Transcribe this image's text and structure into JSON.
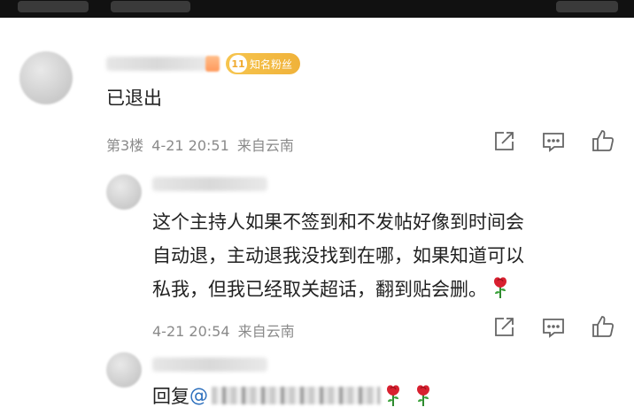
{
  "comment": {
    "fan_badge": {
      "level": "11",
      "label": "知名粉丝"
    },
    "text": "已退出",
    "floor": "第3楼",
    "time": "4-21 20:51",
    "source": "来自云南"
  },
  "reply": {
    "lines": [
      "这个主持人如果不签到和不发帖好像到时间会",
      "自动退，主动退我没找到在哪，如果知道可以",
      "私我，但我已经取关超话，翻到贴会删。"
    ],
    "time": "4-21 20:54",
    "source": "来自云南",
    "emoji": "rose-icon"
  },
  "sub_reply": {
    "prefix": "回复",
    "at": "@",
    "emoji": "rose-icon"
  },
  "icons": [
    "share-icon",
    "comment-icon",
    "like-icon"
  ],
  "colors": {
    "meta": "#8a8a8a",
    "link": "#2c6fbd",
    "badge": "#f0b23a"
  }
}
